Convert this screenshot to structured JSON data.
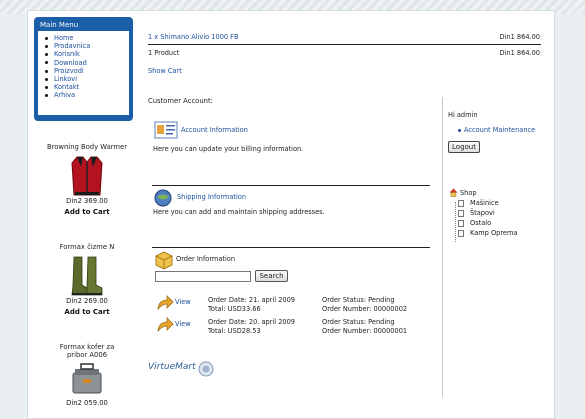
{
  "main_menu": {
    "title": "Main Menu",
    "items": [
      "Home",
      "Prodavnica",
      "Korisnik",
      "Download",
      "Proizvodi",
      "Linkovi",
      "Kontakt",
      "Arhiva"
    ]
  },
  "products": [
    {
      "name": "Browning Body Warmer",
      "price": "Din2 369.00",
      "add_label": "Add to Cart"
    },
    {
      "name": "Formax čizme N",
      "price": "Din2 269.00",
      "add_label": "Add to Cart"
    },
    {
      "name": "Formax kofer za pribor A006",
      "price": "Din2 059.00"
    }
  ],
  "cart": {
    "item": "1 x Shimano Alivio 1000 FB",
    "item_price": "Din1 864.00",
    "count": "1 Product",
    "total": "Din1 864.00",
    "show_cart": "Show Cart"
  },
  "account": {
    "heading": "Customer Account:",
    "account_info_title": "Account Information",
    "account_info_text": "Here you can update your billing information.",
    "shipping_title": "Shipping Information",
    "shipping_text": "Here you can add and maintain shipping addresses.",
    "order_title": "Order Information",
    "search_label": "Search",
    "search_value": ""
  },
  "orders": [
    {
      "view": "View",
      "date": "Order Date: 21. april 2009",
      "total": "Total: USD33.66",
      "status": "Order Status: Pending",
      "number": "Order Number: 00000002"
    },
    {
      "view": "View",
      "date": "Order Date: 20. april 2009",
      "total": "Total: USD28.53",
      "status": "Order Status: Pending",
      "number": "Order Number: 00000001"
    }
  ],
  "sidebar": {
    "greeting": "Hi admin",
    "account_maintenance": "Account Maintenance",
    "logout": "Logout",
    "shop": "Shop",
    "categories": [
      "Mašinice",
      "Štapovi",
      "Ostalo",
      "Kamp Oprema"
    ]
  },
  "branding": {
    "logo": "VirtueMart"
  },
  "colors": {
    "menu_blue": "#1c5fa8",
    "link_blue": "#1a4f9c"
  }
}
